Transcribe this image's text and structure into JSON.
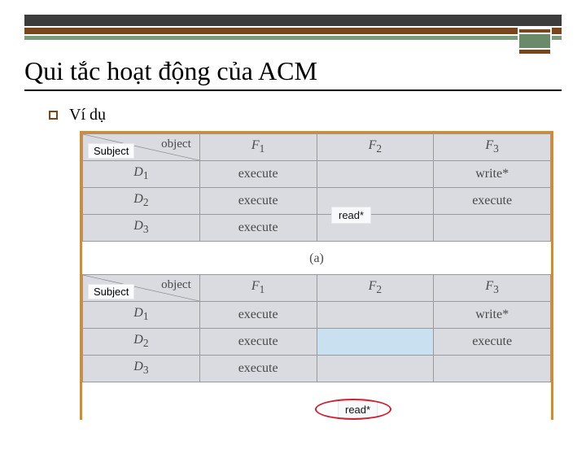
{
  "header": {
    "title": "Qui tắc hoạt động của ACM"
  },
  "bullet": {
    "label": "Ví dụ"
  },
  "diag": {
    "object": "object",
    "subject": "Subject"
  },
  "cols": {
    "f1": "F",
    "f1s": "1",
    "f2": "F",
    "f2s": "2",
    "f3": "F",
    "f3s": "3"
  },
  "rows": {
    "d1": {
      "name": "D",
      "sub": "1",
      "f1": "execute",
      "f2": "",
      "f3": "write*"
    },
    "d2": {
      "name": "D",
      "sub": "2",
      "f1": "execute",
      "f2": "read*",
      "f3": "execute"
    },
    "d3": {
      "name": "D",
      "sub": "3",
      "f1": "execute",
      "f2": "",
      "f3": ""
    }
  },
  "tableB": {
    "d1": {
      "f1": "execute",
      "f2": "",
      "f3": "write*"
    },
    "d2": {
      "f1": "execute",
      "f2": "",
      "f3": "execute"
    },
    "d3": {
      "f1": "execute",
      "f2": "read*",
      "f3": ""
    }
  },
  "caption_a": "(a)",
  "overlay": {
    "read_a": "read*",
    "read_b": "read*"
  }
}
